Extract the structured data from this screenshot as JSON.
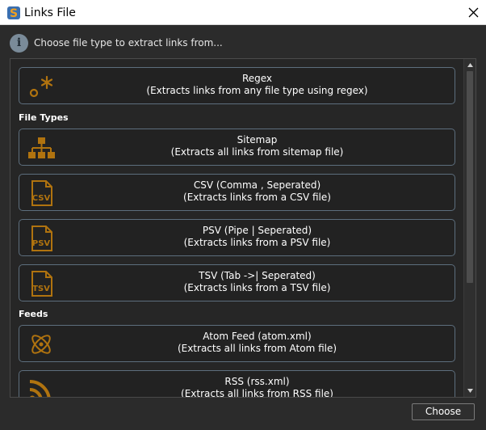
{
  "window": {
    "title": "Links File",
    "accent_color": "#b0730f",
    "logo_colors": [
      "#f0a020",
      "#3a6fb0"
    ]
  },
  "info": {
    "icon": "info-icon",
    "glyph": "i",
    "text": "Choose file type to extract links from..."
  },
  "items": {
    "regex": {
      "title": "Regex",
      "subtitle": "(Extracts links from any file type using regex)",
      "icon": "regex-icon"
    },
    "sitemap": {
      "title": "Sitemap",
      "subtitle": "(Extracts all links from sitemap file)",
      "icon": "sitemap-icon"
    },
    "csv": {
      "title": "CSV (Comma , Seperated)",
      "subtitle": "(Extracts links from a CSV file)",
      "icon": "csv-file-icon",
      "badge": "CSV"
    },
    "psv": {
      "title": "PSV (Pipe | Seperated)",
      "subtitle": "(Extracts links from a PSV file)",
      "icon": "psv-file-icon",
      "badge": "PSV"
    },
    "tsv": {
      "title": "TSV (Tab ->| Seperated)",
      "subtitle": "(Extracts links from a TSV file)",
      "icon": "tsv-file-icon",
      "badge": "TSV"
    },
    "atom": {
      "title": "Atom Feed (atom.xml)",
      "subtitle": "(Extracts all links from Atom file)",
      "icon": "atom-icon"
    },
    "rss": {
      "title": "RSS (rss.xml)",
      "subtitle": "(Extracts all links from RSS file)",
      "icon": "rss-icon"
    }
  },
  "sections": {
    "file_types": "File Types",
    "feeds": "Feeds"
  },
  "footer": {
    "choose_label": "Choose"
  }
}
